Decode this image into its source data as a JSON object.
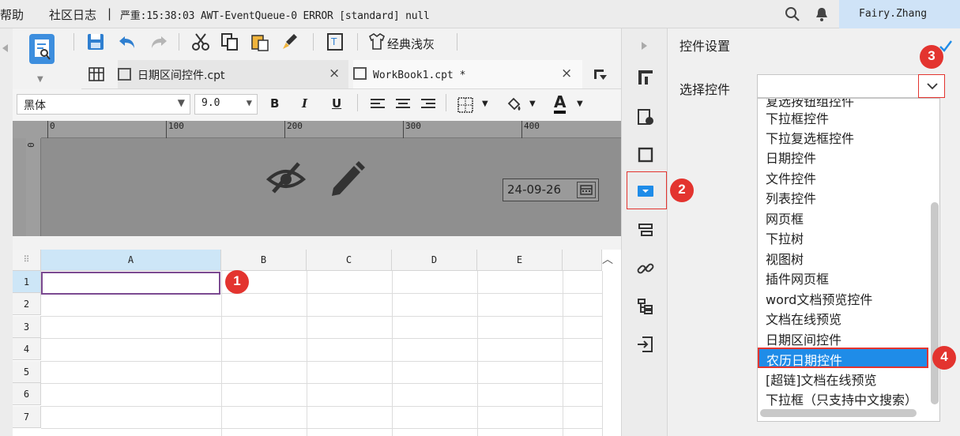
{
  "topbar": {
    "menu_label": "帮助",
    "log_title": "社区日志",
    "separator": "|",
    "log_text": "严重:15:38:03 AWT-EventQueue-0 ERROR [standard] null",
    "user_name": "Fairy.Zhang"
  },
  "toolbar": {
    "theme_label": "经典浅灰"
  },
  "tabs": [
    {
      "label": "日期区间控件.cpt",
      "close": "×"
    },
    {
      "label": "WorkBook1.cpt *",
      "close": "×"
    }
  ],
  "format": {
    "font_family": "黑体",
    "font_size": "9.0",
    "bold": "B",
    "italic": "I",
    "underline": "U",
    "font_color": "A"
  },
  "ruler": {
    "ticks": [
      "0",
      "100",
      "200",
      "300",
      "400"
    ],
    "left_mark": "0"
  },
  "canvas": {
    "date_value": "24-09-26"
  },
  "sheet": {
    "columns": [
      "A",
      "B",
      "C",
      "D",
      "E"
    ],
    "rows": [
      "1",
      "2",
      "3",
      "4",
      "5",
      "6",
      "7"
    ],
    "selected_cell": "A1"
  },
  "panel": {
    "title": "控件设置",
    "select_label": "选择控件",
    "options": [
      "复选按钮组控件",
      "下拉框控件",
      "下拉复选框控件",
      "日期控件",
      "文件控件",
      "列表控件",
      "网页框",
      "下拉树",
      "视图树",
      "插件网页框",
      "word文档预览控件",
      "文档在线预览",
      "日期区间控件",
      "农历日期控件",
      "[超链]文档在线预览",
      "下拉框（只支持中文搜索）"
    ],
    "selected_option": "农历日期控件"
  },
  "callouts": [
    "1",
    "2",
    "3",
    "4"
  ],
  "colors": {
    "accent_red": "#e3342f",
    "selection_blue": "#1f8ce8",
    "user_bg": "#cfe3f7",
    "cell_border": "#7b4a91"
  }
}
